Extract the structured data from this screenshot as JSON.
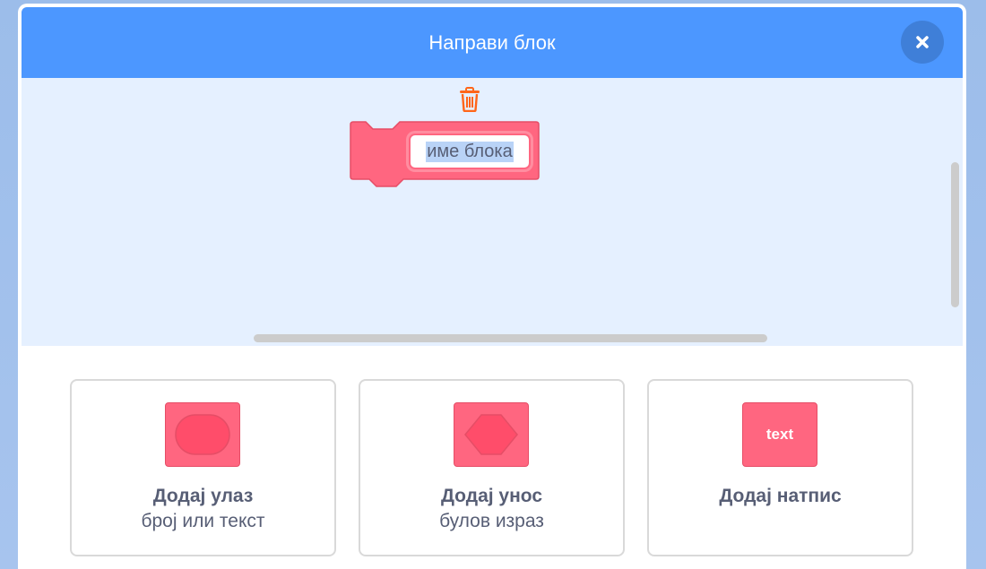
{
  "modal": {
    "title": "Направи блок"
  },
  "workspace": {
    "block": {
      "name_value": "име блока",
      "color": "#ff6680"
    }
  },
  "options": [
    {
      "icon": "round-input-icon",
      "title": "Додај улаз",
      "subtitle": "број или текст"
    },
    {
      "icon": "boolean-input-icon",
      "title": "Додај унос",
      "subtitle": "булов израз"
    },
    {
      "icon": "label-text-icon",
      "icon_text": "text",
      "title": "Додај натпис"
    }
  ],
  "colors": {
    "header": "#4c97ff",
    "workspace": "#e5f0ff",
    "block": "#ff6680",
    "text": "#575e75",
    "trash": "#ff661a"
  }
}
